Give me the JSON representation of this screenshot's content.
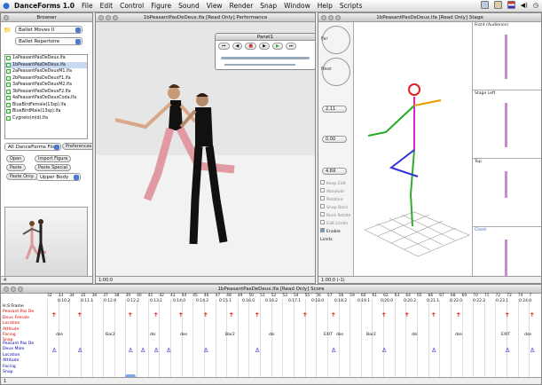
{
  "menubar": {
    "app": "DanceForms 1.0",
    "items": [
      "File",
      "Edit",
      "Control",
      "Figure",
      "Sound",
      "View",
      "Render",
      "Snap",
      "Window",
      "Help",
      "Scripts"
    ]
  },
  "browser": {
    "title": "Browser",
    "combo1": "Ballet Moves II",
    "combo2": "Ballet Repertoire",
    "files": [
      "1aPeasantPasDeDeux.lfa",
      "1bPeasantPasDeDeux.lfa",
      "2aPeasantPasDeDeuxM1.lfa",
      "2bPeasantPasDeDeuxF1.lfa",
      "3aPeasantPasDeDeuxM2.lfa",
      "3bPeasantPasDeDeuxF2.lfa",
      "4aPeasantPasDeDeuxCoda.lfa",
      "BlueBirdFemale(13sp).lfa",
      "BlueBirdMale(13sp).lfa",
      "Cygnets(mid).lfa"
    ],
    "filter": "All DanceForms Files",
    "prefs": "Preferences",
    "buttons": [
      "Open",
      "Import Figure",
      "Paste",
      "Paste Special"
    ],
    "paste_only": "Paste Only:",
    "upper": "Upper Body",
    "status": "4"
  },
  "performance": {
    "title": "1bPeasantPasDeDeux.lfa [Read Only] Performance",
    "time": "1:00:0"
  },
  "panel": {
    "title": "Panel1"
  },
  "stage": {
    "title": "1bPeasantPasDeDeux.lfa [Read Only] Stage",
    "far": "Far",
    "near": "Near",
    "v1": "2.11",
    "v2": "0.00",
    "v3": "4.69",
    "checks": [
      "Keep Edit",
      "Absolute",
      "Relative",
      "Snap Back",
      "Rock Rotate",
      "Edit Limits",
      "Enable Limits"
    ],
    "views": [
      "Front (Audience)",
      "Stage Left",
      "Top",
      "Chest"
    ],
    "time": "1:00:0 (-1)"
  },
  "score": {
    "title": "1bPeasantPasDeDeux.lfa [Read Only] Score",
    "frames": [
      "32",
      "33",
      "34",
      "35",
      "36",
      "37",
      "38",
      "39",
      "40",
      "41",
      "42",
      "43",
      "44",
      "45",
      "46",
      "47",
      "48",
      "49",
      "50",
      "51",
      "52",
      "53",
      "54",
      "55",
      "56",
      "57",
      "58",
      "59",
      "60",
      "61",
      "62",
      "63",
      "64",
      "65",
      "66",
      "67",
      "68",
      "69",
      "70",
      "71",
      "72",
      "73",
      "74",
      "7"
    ],
    "times": [
      "0:10.2",
      "0:11.1",
      "0:12.0",
      "0:12.2",
      "0:13.1",
      "0:14.0",
      "0:14.2",
      "0:15.1",
      "0:16.0",
      "0:16.2",
      "0:17.1",
      "0:18.0",
      "0:18.2",
      "0:19.1",
      "0:20.0",
      "0:20.2",
      "0:21.1",
      "0:22.0",
      "0:22.2",
      "0:23.1",
      "0:24.0"
    ],
    "rows": [
      {
        "label": "H:S:Frame",
        "color": "#000"
      },
      {
        "label": "Peasant Pas De",
        "color": "#d00"
      },
      {
        "label": "Deux Female",
        "color": "#d00"
      },
      {
        "label": "Location",
        "color": "#d00"
      },
      {
        "label": "Attitude",
        "color": "#d00"
      },
      {
        "label": "Facing",
        "color": "#d00"
      },
      {
        "label": "Snap",
        "color": "#d00"
      },
      {
        "label": "Peasant Pas De",
        "color": "#00a"
      },
      {
        "label": "Deux Male",
        "color": "#00a"
      },
      {
        "label": "Location",
        "color": "#00a"
      },
      {
        "label": "Attitude",
        "color": "#00a"
      },
      {
        "label": "Facing",
        "color": "#00a"
      },
      {
        "label": "Snap",
        "color": "#00a"
      }
    ],
    "beats": [
      "dse",
      "Bar2",
      "dsi",
      "dse",
      "Bar2",
      "dsi",
      "EXIT",
      "dse",
      "Bar2",
      "dsi",
      "dse",
      "EXIT",
      "dse"
    ],
    "bottom": "1"
  }
}
